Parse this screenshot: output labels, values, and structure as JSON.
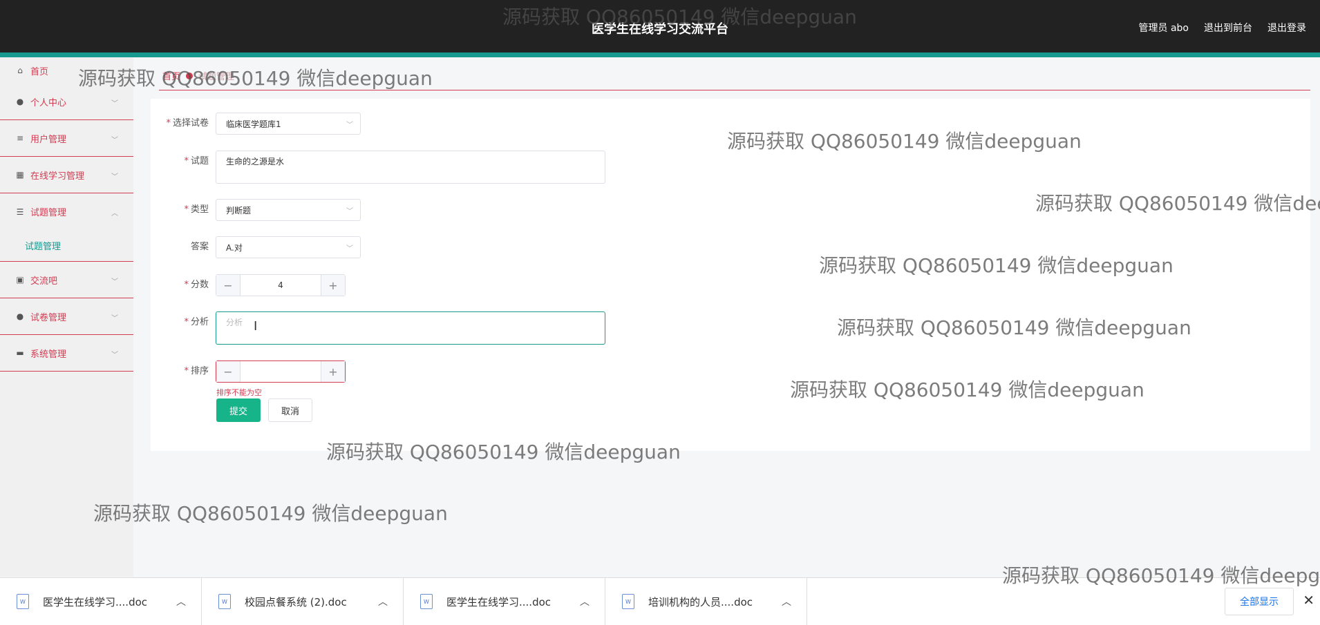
{
  "header": {
    "title": "医学生在线学习交流平台",
    "user": "管理员 abo",
    "to_front": "退出到前台",
    "logout": "退出登录"
  },
  "sidebar": {
    "items": [
      {
        "label": "首页",
        "icon": "home-icon"
      },
      {
        "label": "个人中心",
        "icon": "user-icon"
      },
      {
        "label": "用户管理",
        "icon": "list-icon"
      },
      {
        "label": "在线学习管理",
        "icon": "grid-icon"
      },
      {
        "label": "试题管理",
        "icon": "sliders-icon"
      },
      {
        "label": "交流吧",
        "icon": "clipboard-icon"
      },
      {
        "label": "试卷管理",
        "icon": "user-icon"
      },
      {
        "label": "系统管理",
        "icon": "briefcase-icon"
      }
    ],
    "sub_active": "试题管理"
  },
  "breadcrumb": {
    "home": "首页",
    "current": "试题管理"
  },
  "form": {
    "paper_label": "选择试卷",
    "paper_value": "临床医学题库1",
    "question_label": "试题",
    "question_value": "生命的之源是水",
    "type_label": "类型",
    "type_value": "判断题",
    "answer_label": "答案",
    "answer_value": "A.对",
    "score_label": "分数",
    "score_value": "4",
    "analysis_label": "分析",
    "analysis_placeholder": "分析",
    "order_label": "排序",
    "order_value": "",
    "order_error": "排序不能为空",
    "submit_label": "提交",
    "cancel_label": "取消"
  },
  "watermark": "源码获取 QQ86050149 微信deepguan",
  "downloads": {
    "items": [
      "医学生在线学习....doc",
      "校园点餐系统 (2).doc",
      "医学生在线学习....doc",
      "培训机构的人员....doc"
    ],
    "show_all": "全部显示"
  }
}
